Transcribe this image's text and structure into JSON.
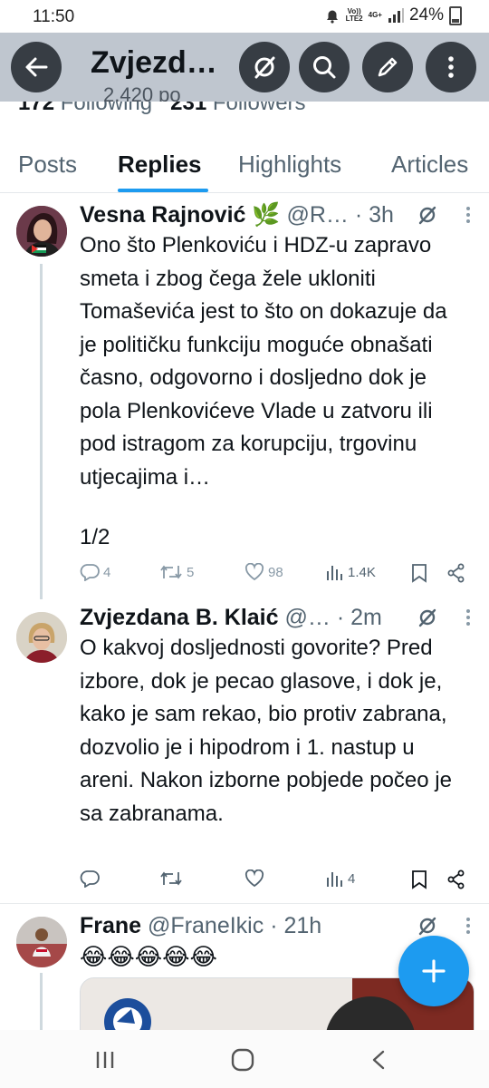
{
  "status_bar": {
    "time": "11:50",
    "volte": "Vo))\nLTE2",
    "network": "4G+",
    "battery": "24%"
  },
  "header": {
    "title": "Zvjezd…",
    "subtitle": "2,420 po",
    "behind_title": "Zvjezdana B. Klaić"
  },
  "profile_counts": {
    "following_count": "172",
    "following_label": "Following",
    "followers_count": "231",
    "followers_label": "Followers"
  },
  "tabs": [
    {
      "label": "Posts"
    },
    {
      "label": "Replies"
    },
    {
      "label": "Highlights"
    },
    {
      "label": "Articles"
    }
  ],
  "posts": [
    {
      "name": "Vesna Rajnović",
      "emoji": "🌿",
      "handle": "@R…",
      "time": "· 3h",
      "text": "Ono što Plenkoviću i HDZ-u zapravo smeta i zbog čega žele ukloniti Tomaševića jest to što on dokazuje da je političku funkciju moguće obnašati časno, odgovorno i dosljedno dok je pola Plenkovićeve Vlade u zatvoru ili pod istragom za korupciju, trgovinu utjecajima i…",
      "thread_marker": "1/2",
      "replies": "4",
      "reposts": "5",
      "likes": "98",
      "views": "1.4K"
    },
    {
      "name": "Zvjezdana B. Klaić",
      "handle": "@…",
      "time": "· 2m",
      "text": "O kakvoj dosljednosti govorite? Pred izbore, dok je pecao glasove, i dok je, kako je sam rekao, bio protiv zabrana, dozvolio je i hipodrom i 1. nastup u areni. Nakon izborne pobjede počeo je sa zabranama.",
      "replies": "",
      "reposts": "",
      "likes": "",
      "views": "4"
    },
    {
      "name": "Frane",
      "handle": "@FraneIkic",
      "time": "· 21h",
      "text": "😂😂😂😂😂"
    }
  ],
  "icons": {
    "back": "arrow-left-icon",
    "grok": "grok-icon",
    "search": "search-icon",
    "edit": "pencil-icon",
    "more": "more-vertical-icon",
    "compose": "plus-icon"
  },
  "colors": {
    "accent": "#1d9bf0",
    "text": "#0f1419",
    "muted": "#536471",
    "header_bg": "#bfc6cf"
  }
}
